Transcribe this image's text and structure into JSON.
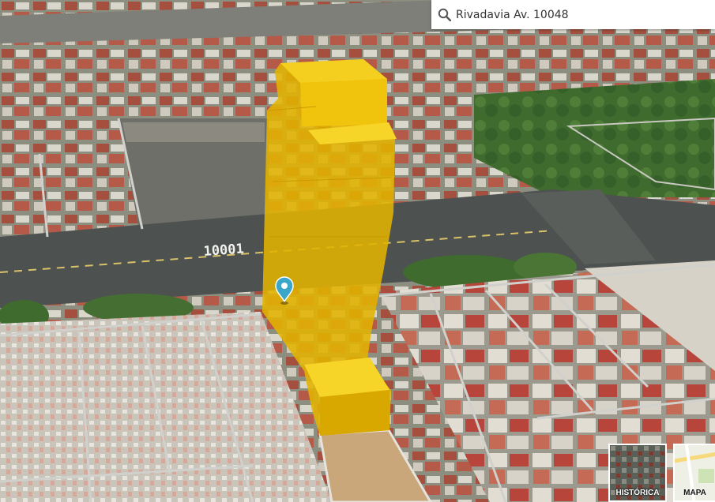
{
  "search": {
    "value": "Rivadavia Av. 10048",
    "icon": "search-icon"
  },
  "map": {
    "street_number": "10001",
    "marker_icon": "location-pin-icon",
    "building_color": "#e9b800"
  },
  "layers": [
    {
      "label": "HISTÓRICA"
    },
    {
      "label": "MAPA"
    }
  ]
}
